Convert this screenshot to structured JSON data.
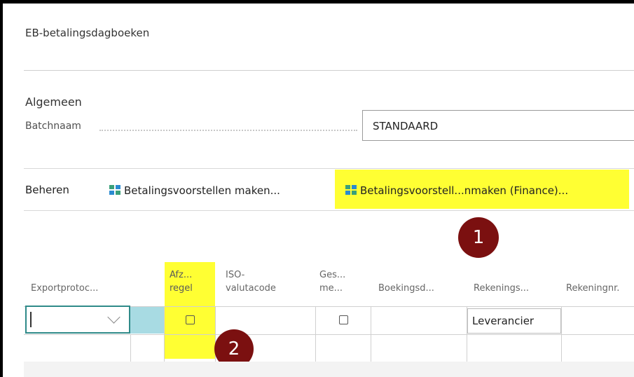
{
  "page": {
    "title": "EB-betalingsdagboeken"
  },
  "general": {
    "section_title": "Algemeen",
    "batch_label": "Batchnaam",
    "batch_value": "STANDAARD"
  },
  "actions": {
    "manage_label": "Beheren",
    "suggest_label": "Betalingsvoorstellen maken...",
    "suggest_finance_label": "Betalingsvoorstell...nmaken (Finance)..."
  },
  "badges": [
    "1",
    "2"
  ],
  "columns": [
    {
      "line1": "",
      "line2": "Exportprotoc..."
    },
    {
      "line1": "Afz...",
      "line2": "regel"
    },
    {
      "line1": "ISO-",
      "line2": "valutacode"
    },
    {
      "line1": "Ges...",
      "line2": "me..."
    },
    {
      "line1": "",
      "line2": "Boekingsd..."
    },
    {
      "line1": "",
      "line2": "Rekenings..."
    },
    {
      "line1": "",
      "line2": "Rekeningnr."
    }
  ],
  "row1": {
    "account_type": "Leverancier"
  },
  "colors": {
    "highlight": "#ffff33",
    "badge": "#7b1010",
    "focus": "#2f8a89",
    "cyan": "#a8dbe3"
  }
}
